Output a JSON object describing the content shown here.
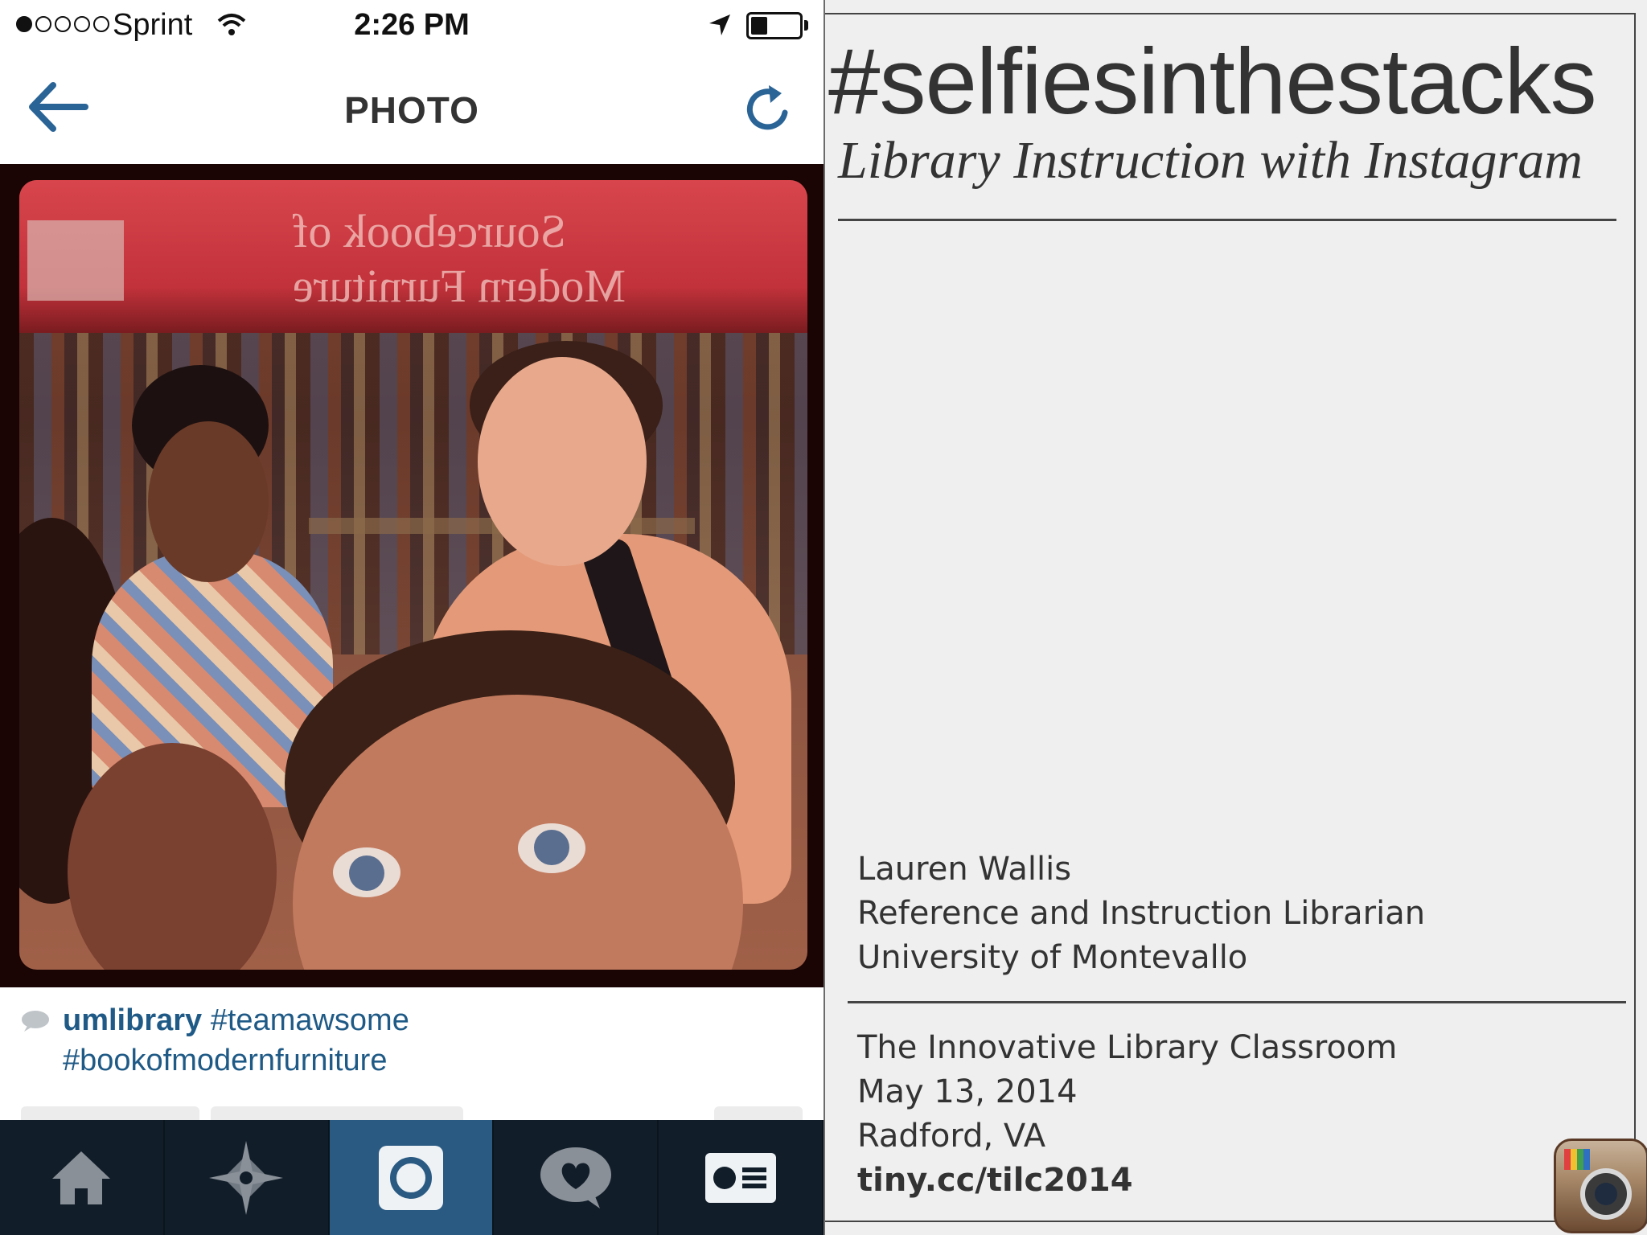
{
  "status_bar": {
    "carrier": "Sprint",
    "time": "2:26 PM",
    "signal_bars_filled": 1,
    "signal_bars_total": 5,
    "battery_level": 0.35
  },
  "nav": {
    "title": "PHOTO",
    "back_icon": "back-arrow-icon",
    "refresh_icon": "refresh-icon"
  },
  "photo": {
    "sign_line1": "Sourcebook of",
    "sign_line2": "Modern Furniture"
  },
  "caption": {
    "username": "umlibrary",
    "tag1": "#teamawsome",
    "tag2": "#bookofmodernfurniture"
  },
  "tab_bar": {
    "tabs": [
      {
        "icon": "home-icon"
      },
      {
        "icon": "explore-star-icon"
      },
      {
        "icon": "camera-icon",
        "active": true
      },
      {
        "icon": "activity-heart-icon"
      },
      {
        "icon": "profile-card-icon"
      }
    ]
  },
  "slide": {
    "title": "#selfiesinthestacks",
    "subtitle": "Library Instruction with Instagram",
    "presenter_name": "Lauren Wallis",
    "presenter_role": "Reference and Instruction Librarian",
    "presenter_org": "University of Montevallo",
    "event_name": "The Innovative Library Classroom",
    "event_date": "May 13, 2014",
    "event_location": "Radford, VA",
    "event_link": "tiny.cc/tilc2014",
    "logo_icon": "instagram-logo-icon"
  },
  "colors": {
    "link_blue": "#1f5a86",
    "tab_bar_bg": "#111e2a",
    "tab_active_bg": "#2a5a82",
    "slide_bg": "#efeff0",
    "sign_red": "#c2323b"
  }
}
